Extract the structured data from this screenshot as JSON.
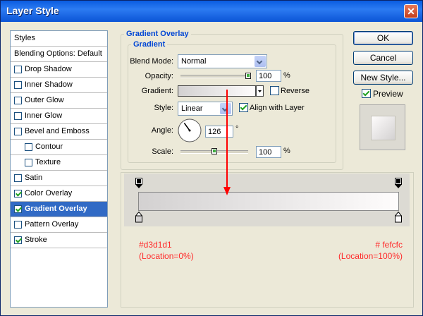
{
  "window": {
    "title": "Layer Style",
    "close_glyph": "✕"
  },
  "styles_list": [
    {
      "label": "Styles",
      "checkbox": false,
      "checked": false,
      "selected": false,
      "indent": 0
    },
    {
      "label": "Blending Options: Default",
      "checkbox": false,
      "checked": false,
      "selected": false,
      "indent": 0
    },
    {
      "label": "Drop Shadow",
      "checkbox": true,
      "checked": false,
      "selected": false,
      "indent": 0
    },
    {
      "label": "Inner Shadow",
      "checkbox": true,
      "checked": false,
      "selected": false,
      "indent": 0
    },
    {
      "label": "Outer Glow",
      "checkbox": true,
      "checked": false,
      "selected": false,
      "indent": 0
    },
    {
      "label": "Inner Glow",
      "checkbox": true,
      "checked": false,
      "selected": false,
      "indent": 0
    },
    {
      "label": "Bevel and Emboss",
      "checkbox": true,
      "checked": false,
      "selected": false,
      "indent": 0
    },
    {
      "label": "Contour",
      "checkbox": true,
      "checked": false,
      "selected": false,
      "indent": 1
    },
    {
      "label": "Texture",
      "checkbox": true,
      "checked": false,
      "selected": false,
      "indent": 1
    },
    {
      "label": "Satin",
      "checkbox": true,
      "checked": false,
      "selected": false,
      "indent": 0
    },
    {
      "label": "Color Overlay",
      "checkbox": true,
      "checked": true,
      "selected": false,
      "indent": 0
    },
    {
      "label": "Gradient Overlay",
      "checkbox": true,
      "checked": true,
      "selected": true,
      "indent": 0
    },
    {
      "label": "Pattern Overlay",
      "checkbox": true,
      "checked": false,
      "selected": false,
      "indent": 0
    },
    {
      "label": "Stroke",
      "checkbox": true,
      "checked": true,
      "selected": false,
      "indent": 0
    }
  ],
  "panel": {
    "group_title": "Gradient Overlay",
    "sub_title": "Gradient",
    "blend_mode": {
      "label": "Blend Mode:",
      "value": "Normal"
    },
    "opacity": {
      "label": "Opacity:",
      "value": "100",
      "unit": "%",
      "level": 1.0
    },
    "gradient": {
      "label": "Gradient:",
      "reverse_label": "Reverse",
      "reverse_checked": false
    },
    "style": {
      "label": "Style:",
      "value": "Linear",
      "align_label": "Align with Layer",
      "align_checked": true
    },
    "angle": {
      "label": "Angle:",
      "value": "126",
      "unit": "°",
      "degrees": 126
    },
    "scale": {
      "label": "Scale:",
      "value": "100",
      "unit": "%",
      "level": 0.5
    }
  },
  "buttons": {
    "ok": "OK",
    "cancel": "Cancel",
    "new_style": "New Style...",
    "preview_label": "Preview",
    "preview_checked": true
  },
  "gradient_editor": {
    "start_color": "#d3d1d1",
    "end_color": "#fefcfc",
    "left_annotation": {
      "color_text": "#d3d1d1",
      "location_text": "(Location=0%)"
    },
    "right_annotation": {
      "color_text": "# fefcfc",
      "location_text": "(Location=100%)"
    }
  },
  "annotation_color": "#ff2a2a"
}
